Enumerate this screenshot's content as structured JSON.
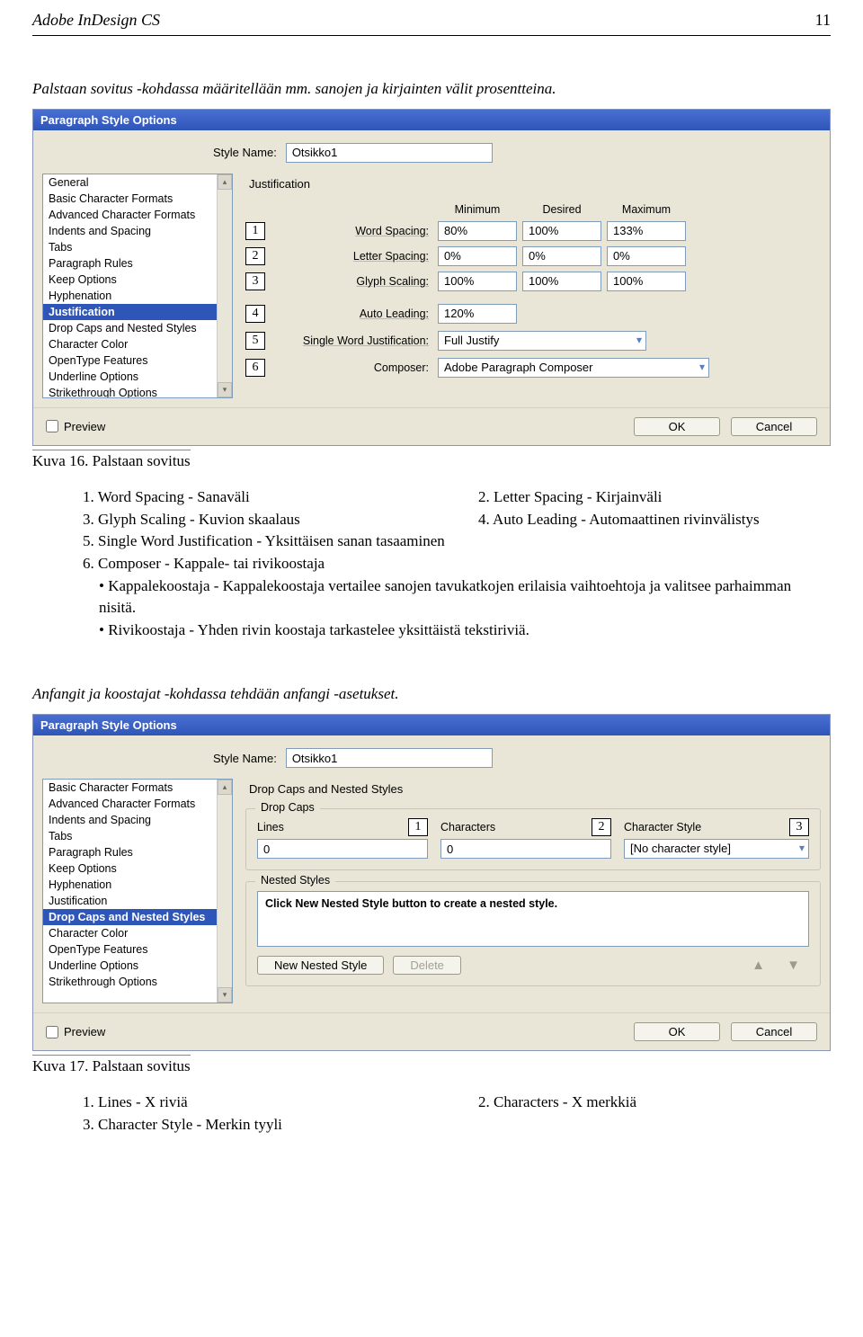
{
  "page": {
    "doc_title": "Adobe InDesign CS",
    "page_number": "11"
  },
  "intro": "Palstaan sovitus -kohdassa määritellään mm. sanojen ja kirjainten välit prosentteina.",
  "dialog1": {
    "title": "Paragraph Style Options",
    "style_label": "Style Name:",
    "style_value": "Otsikko1",
    "categories": [
      "General",
      "Basic Character Formats",
      "Advanced Character Formats",
      "Indents and Spacing",
      "Tabs",
      "Paragraph Rules",
      "Keep Options",
      "Hyphenation",
      "Justification",
      "Drop Caps and Nested Styles",
      "Character Color",
      "OpenType Features",
      "Underline Options",
      "Strikethrough Options"
    ],
    "selected_index": 8,
    "section": "Justification",
    "cols": {
      "min": "Minimum",
      "des": "Desired",
      "max": "Maximum"
    },
    "rows": [
      {
        "n": "1",
        "label": "Word Spacing:",
        "min": "80%",
        "des": "100%",
        "max": "133%"
      },
      {
        "n": "2",
        "label": "Letter Spacing:",
        "min": "0%",
        "des": "0%",
        "max": "0%"
      },
      {
        "n": "3",
        "label": "Glyph Scaling:",
        "min": "100%",
        "des": "100%",
        "max": "100%"
      }
    ],
    "auto_leading": {
      "n": "4",
      "label": "Auto Leading:",
      "value": "120%"
    },
    "swj": {
      "n": "5",
      "label": "Single Word Justification:",
      "value": "Full Justify"
    },
    "composer": {
      "n": "6",
      "label": "Composer:",
      "value": "Adobe Paragraph Composer"
    },
    "preview": "Preview",
    "ok": "OK",
    "cancel": "Cancel"
  },
  "caption1": "Kuva 16. Palstaan sovitus",
  "list1": {
    "l1": "1. Word Spacing - Sanaväli",
    "r1": "2. Letter Spacing - Kirjainväli",
    "l2": "3. Glyph Scaling - Kuvion skaalaus",
    "r2": "4. Auto Leading - Automaattinen rivinvälistys",
    "l3": "5. Single Word Justification - Yksittäisen sanan tasaaminen",
    "l4": "6. Composer - Kappale- tai rivikoostaja",
    "b1": "Kappalekoostaja - Kappalekoostaja vertailee sanojen tavukatkojen erilaisia vaihtoehtoja ja valitsee parhaimman nisitä.",
    "b2": "Rivikoostaja - Yhden rivin koostaja tarkastelee yksittäistä tekstiriviä."
  },
  "intro2": "Anfangit ja koostajat -kohdassa tehdään anfangi -asetukset.",
  "dialog2": {
    "title": "Paragraph Style Options",
    "style_label": "Style Name:",
    "style_value": "Otsikko1",
    "categories": [
      "Basic Character Formats",
      "Advanced Character Formats",
      "Indents and Spacing",
      "Tabs",
      "Paragraph Rules",
      "Keep Options",
      "Hyphenation",
      "Justification",
      "Drop Caps and Nested Styles",
      "Character Color",
      "OpenType Features",
      "Underline Options",
      "Strikethrough Options"
    ],
    "selected_index": 8,
    "section": "Drop Caps and Nested Styles",
    "dropcaps_legend": "Drop Caps",
    "lines": {
      "n": "1",
      "label": "Lines",
      "value": "0"
    },
    "chars": {
      "n": "2",
      "label": "Characters",
      "value": "0"
    },
    "cstyle": {
      "n": "3",
      "label": "Character Style",
      "value": "[No character style]"
    },
    "nested_legend": "Nested Styles",
    "nested_msg": "Click New Nested Style button to create a nested style.",
    "new_btn": "New Nested Style",
    "del_btn": "Delete",
    "preview": "Preview",
    "ok": "OK",
    "cancel": "Cancel"
  },
  "caption2": "Kuva 17. Palstaan sovitus",
  "list2": {
    "l1": "1. Lines - X riviä",
    "r1": "2. Characters - X merkkiä",
    "l2": "3. Character Style - Merkin tyyli"
  }
}
